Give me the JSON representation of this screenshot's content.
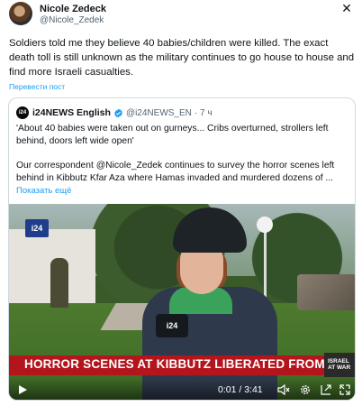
{
  "author": {
    "name": "Nicole Zedeck",
    "handle": "@Nicole_Zedek"
  },
  "tweet": {
    "text": "Soldiers told me they believe 40 babies/children were killed. The exact death toll is still unknown as the military continues to go house to house and find more Israeli casualties.",
    "translate_label": "Перевести пост"
  },
  "quoted": {
    "logo_text": "i24",
    "name": "i24NEWS English",
    "handle": "@i24NEWS_EN",
    "time": "· 7 ч",
    "text_line1": "'About 40 babies were taken out on gurneys... Cribs overturned, strollers left behind, doors left wide open'",
    "text_line2a": "Our correspondent @Nicole_Zedek continues to survey the horror scenes left",
    "text_line2b": "behind in Kibbutz Kfar Aza where Hamas invaded and murdered dozens of ...",
    "show_more": "Показать ещё"
  },
  "video": {
    "channel_logo": "i24",
    "mic_label": "i24",
    "banner_text": "HORROR SCENES AT KIBBUTZ LIBERATED FROM HAMAS",
    "banner_badge_line1": "ISRAEL",
    "banner_badge_line2": "AT WAR",
    "time": "0:01 / 3:41"
  },
  "colors": {
    "link": "#1d9bf0",
    "verified": "#1d9bf0",
    "banner": "#b4151c"
  },
  "icons": [
    "close-icon",
    "verified-icon",
    "play-icon",
    "volume-icon",
    "settings-icon",
    "pip-icon",
    "fullscreen-icon"
  ]
}
